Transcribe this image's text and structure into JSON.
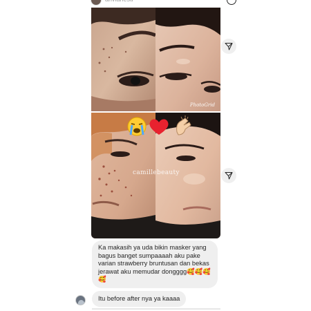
{
  "header": {
    "username": "arivianesti",
    "icons": [
      "avatar",
      "info-icon"
    ]
  },
  "photos": [
    {
      "id": "photo-1",
      "watermark": "PhotoGrid"
    },
    {
      "id": "photo-2",
      "caption": "camillebeauty",
      "emojis": [
        "crying-face-emoji",
        "red-heart-emoji",
        "clapping-hands-emoji"
      ]
    }
  ],
  "share_icon": "paper-plane-icon",
  "messages": [
    {
      "text": "Ka makasih ya uda bikin masker yang\nbagus banget sumpaaaah aku pake\nvarian strawberry bruntusan dan bekas\njerawat aku memudar dongggg🥰🥰🥰\n🥰"
    },
    {
      "text": "Itu before after nya ya kaaaa"
    }
  ],
  "colors": {
    "bubble": "#efefef",
    "text": "#262626",
    "background": "#ffffff"
  }
}
